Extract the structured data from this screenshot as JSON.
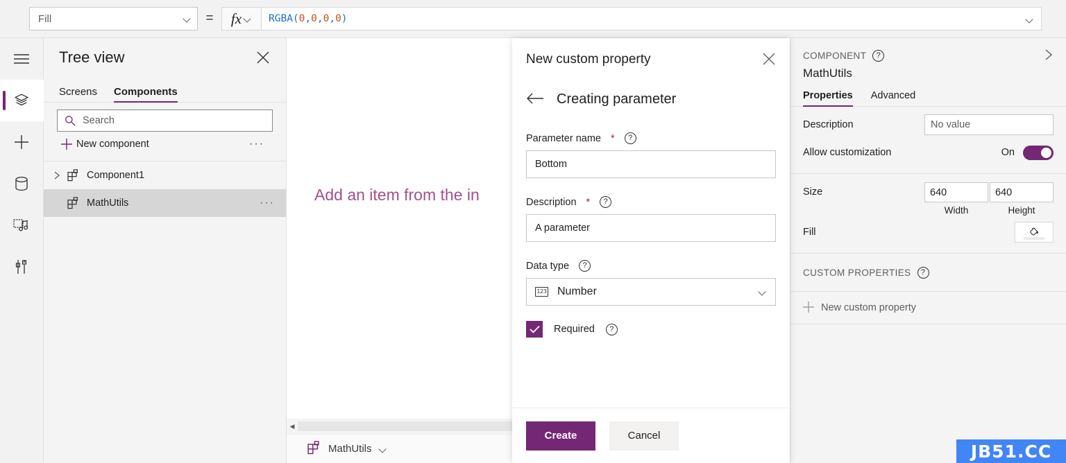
{
  "formula_bar": {
    "property_selected": "Fill",
    "equals": "=",
    "fx_label": "fx",
    "formula_parts": {
      "fn": "RGBA(",
      "a": "0",
      "sep1": ", ",
      "b": "0",
      "sep2": ", ",
      "c": "0",
      "sep3": ", ",
      "d": "0",
      "close": ")"
    }
  },
  "left_rail": {
    "items": [
      {
        "name": "hamburger-menu-icon",
        "label": "Menu"
      },
      {
        "name": "tree-view-icon",
        "label": "Tree view"
      },
      {
        "name": "insert-icon",
        "label": "Insert"
      },
      {
        "name": "data-icon",
        "label": "Data"
      },
      {
        "name": "media-icon",
        "label": "Media"
      },
      {
        "name": "advanced-tools-icon",
        "label": "Advanced tools"
      }
    ]
  },
  "tree_view": {
    "title": "Tree view",
    "tabs": [
      {
        "label": "Screens",
        "active": false
      },
      {
        "label": "Components",
        "active": true
      }
    ],
    "search_placeholder": "Search",
    "new_component_label": "New component",
    "items": [
      {
        "label": "Component1",
        "expandable": true,
        "selected": false,
        "has_menu": false
      },
      {
        "label": "MathUtils",
        "expandable": false,
        "selected": true,
        "has_menu": true
      }
    ]
  },
  "canvas": {
    "hint_text": "Add an item from the in",
    "footer_component": "MathUtils"
  },
  "dialog": {
    "title": "New custom property",
    "subtitle": "Creating parameter",
    "fields": {
      "parameter_name_label": "Parameter name",
      "parameter_name_required_mark": "*",
      "parameter_name_value": "Bottom",
      "description_label": "Description",
      "description_required_mark": "*",
      "description_value": "A parameter",
      "data_type_label": "Data type",
      "data_type_value": "Number",
      "data_type_icon_text": "123",
      "required_label": "Required",
      "required_checked": true
    },
    "buttons": {
      "create": "Create",
      "cancel": "Cancel"
    }
  },
  "right_panel": {
    "kicker": "COMPONENT",
    "component_name": "MathUtils",
    "tabs": [
      {
        "label": "Properties",
        "active": true
      },
      {
        "label": "Advanced",
        "active": false
      }
    ],
    "description_label": "Description",
    "description_placeholder": "No value",
    "allow_customization_label": "Allow customization",
    "allow_customization_state": "On",
    "size_label": "Size",
    "size_width": "640",
    "size_height": "640",
    "width_caption": "Width",
    "height_caption": "Height",
    "fill_label": "Fill",
    "custom_properties_header": "CUSTOM PROPERTIES",
    "new_custom_property": "New custom property"
  },
  "watermark": {
    "text": "JB51.CC"
  },
  "colors": {
    "accent_purple": "#742774",
    "canvas_hint": "#a4508a",
    "formula_fn_blue": "#1c6ec4",
    "formula_num_orange": "#c4511c",
    "watermark_blue": "#4285f4",
    "required_star_red": "#a4262c"
  }
}
